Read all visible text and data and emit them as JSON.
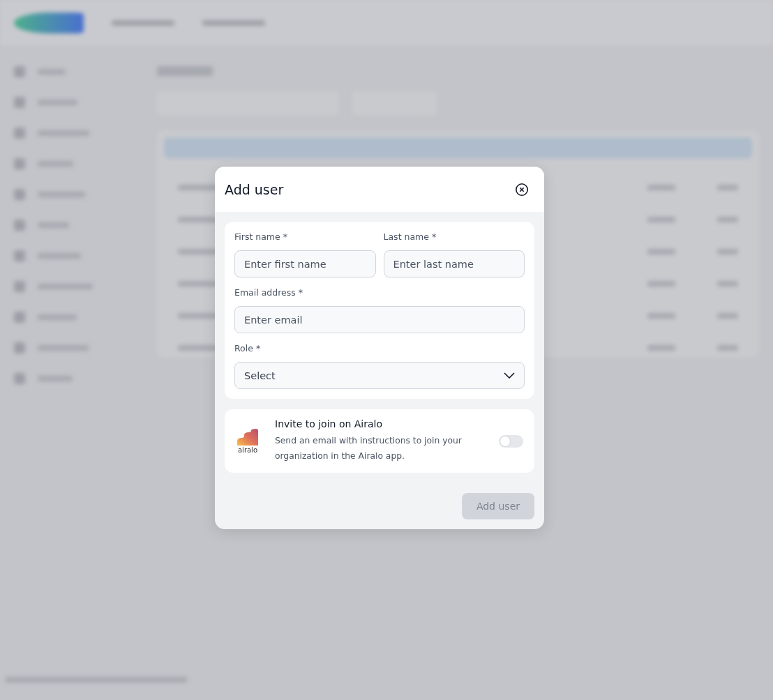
{
  "dialog": {
    "title": "Add user",
    "field_rows": [
      [
        {
          "label": "First name *",
          "placeholder": "Enter first name",
          "kind": "text"
        },
        {
          "label": "Last name *",
          "placeholder": "Enter last name",
          "kind": "text"
        }
      ],
      [
        {
          "label": "Email address *",
          "placeholder": "Enter email",
          "kind": "text"
        }
      ],
      [
        {
          "label": "Role *",
          "value": "Select",
          "kind": "select"
        }
      ]
    ],
    "invite": {
      "title": "Invite to join on Airalo",
      "description": "Send an email with instructions to join your organization in the Airalo app.",
      "logo_text": "airalo",
      "on": false
    },
    "submit": {
      "label": "Add user",
      "disabled": true
    }
  }
}
